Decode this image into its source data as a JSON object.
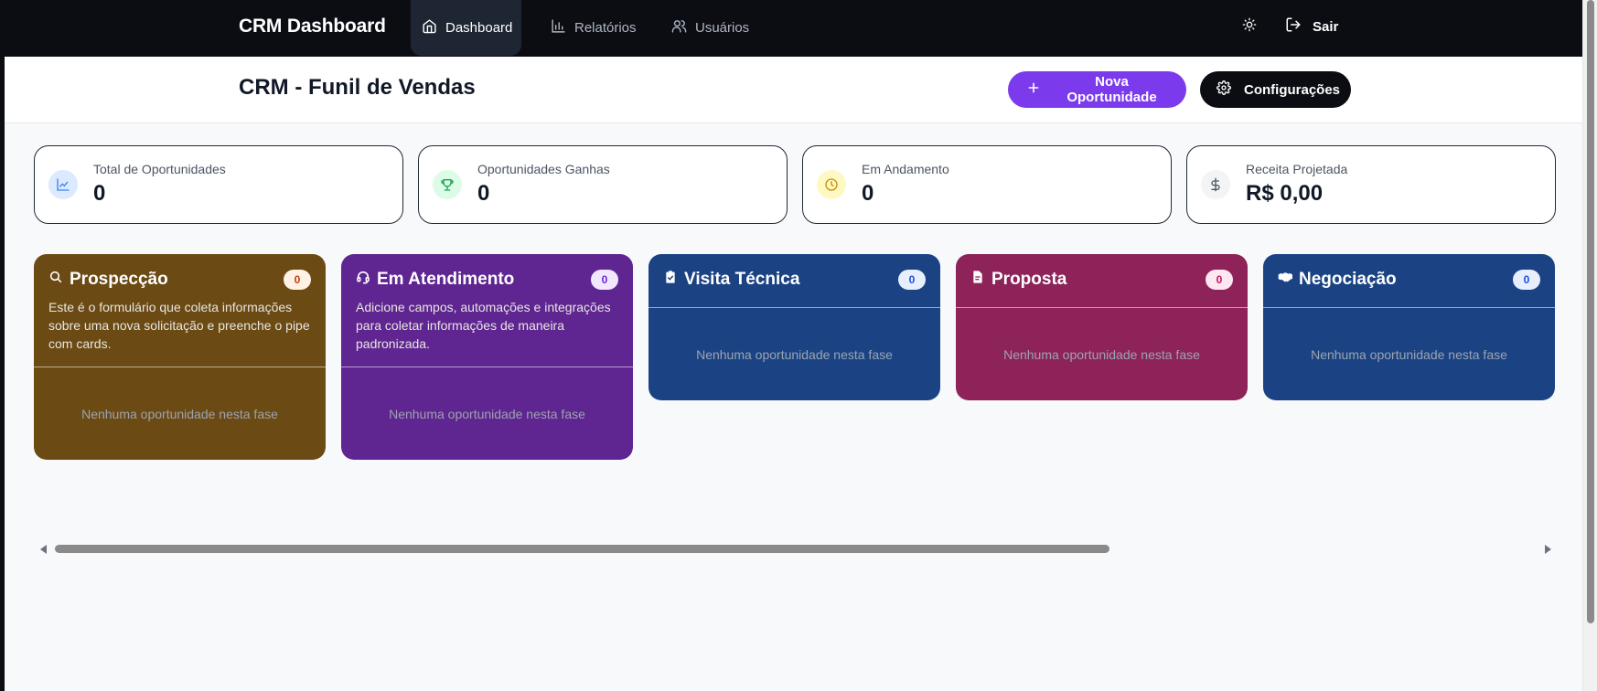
{
  "nav": {
    "brand": "CRM Dashboard",
    "items": [
      {
        "label": "Dashboard",
        "icon": "home-icon",
        "active": true
      },
      {
        "label": "Relatórios",
        "icon": "bar-chart-icon",
        "active": false
      },
      {
        "label": "Usuários",
        "icon": "users-icon",
        "active": false
      }
    ],
    "theme_icon": "sun-icon",
    "logout_label": "Sair"
  },
  "header": {
    "title": "CRM - Funil de Vendas",
    "new_button": "Nova Oportunidade",
    "config_button": "Configurações"
  },
  "stats": [
    {
      "label": "Total de Oportunidades",
      "value": "0",
      "icon": "trend-chart-icon",
      "color": "#3b82f6"
    },
    {
      "label": "Oportunidades Ganhas",
      "value": "0",
      "icon": "trophy-icon",
      "color": "#16a34a"
    },
    {
      "label": "Em Andamento",
      "value": "0",
      "icon": "clock-icon",
      "color": "#ca8a04"
    },
    {
      "label": "Receita Projetada",
      "value": "R$ 0,00",
      "icon": "dollar-icon",
      "color": "#4b5563"
    }
  ],
  "columns": [
    {
      "title": "Prospecção",
      "count": "0",
      "icon": "search-icon",
      "color": "#6b4a14",
      "description": "Este é o formulário que coleta informações sobre uma nova solicitação e preenche o pipe com cards.",
      "empty": "Nenhuma oportunidade nesta fase"
    },
    {
      "title": "Em Atendimento",
      "count": "0",
      "icon": "headset-icon",
      "color": "#5f2591",
      "description": "Adicione campos, automações e integrações para coletar informações de maneira padronizada.",
      "empty": "Nenhuma oportunidade nesta fase"
    },
    {
      "title": "Visita Técnica",
      "count": "0",
      "icon": "clipboard-check-icon",
      "color": "#1b4384",
      "empty": "Nenhuma oportunidade nesta fase"
    },
    {
      "title": "Proposta",
      "count": "0",
      "icon": "document-icon",
      "color": "#8e2359",
      "empty": "Nenhuma oportunidade nesta fase"
    },
    {
      "title": "Negociação",
      "count": "0",
      "icon": "handshake-icon",
      "color": "#1b4384",
      "empty": "Nenhuma oportunidade nesta fase"
    }
  ]
}
